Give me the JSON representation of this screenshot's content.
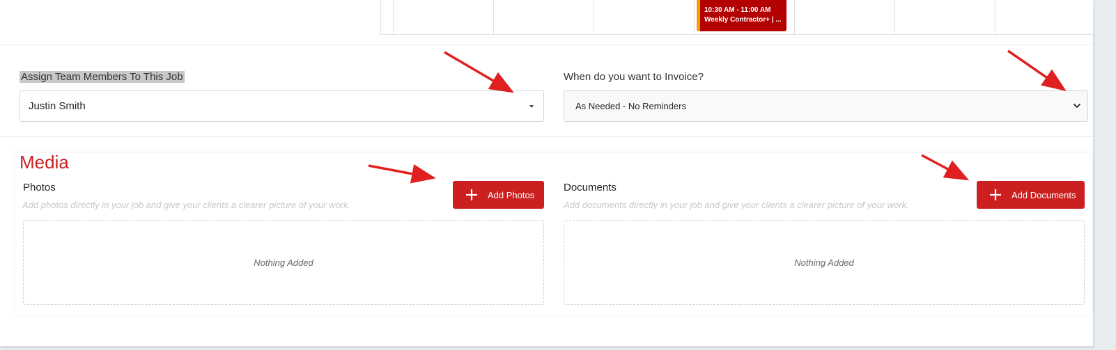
{
  "calendar": {
    "event_time": "10:30 AM - 11:00 AM",
    "event_title": "Weekly Contractor+ | ..."
  },
  "assign": {
    "label": "Assign Team Members To This Job",
    "value": "Justin Smith"
  },
  "invoice": {
    "label": "When do you want to Invoice?",
    "value": "As Needed - No Reminders"
  },
  "media": {
    "title": "Media",
    "photos": {
      "title": "Photos",
      "hint": "Add photos directly in your job and give your clients a clearer picture of your work.",
      "button_label": "Add Photos",
      "empty_text": "Nothing Added"
    },
    "documents": {
      "title": "Documents",
      "hint": "Add documents directly in your job and give your clients a clearer picture of your work.",
      "button_label": "Add Documents",
      "empty_text": "Nothing Added"
    }
  },
  "colors": {
    "accent": "#cc1f1f",
    "event_bg": "#b30000",
    "event_border": "#f0a000",
    "annotation_arrow": "#e02020"
  },
  "icons": [
    "caret-down-icon",
    "chevron-down-icon",
    "plus-icon",
    "annotation-arrow-icon"
  ]
}
